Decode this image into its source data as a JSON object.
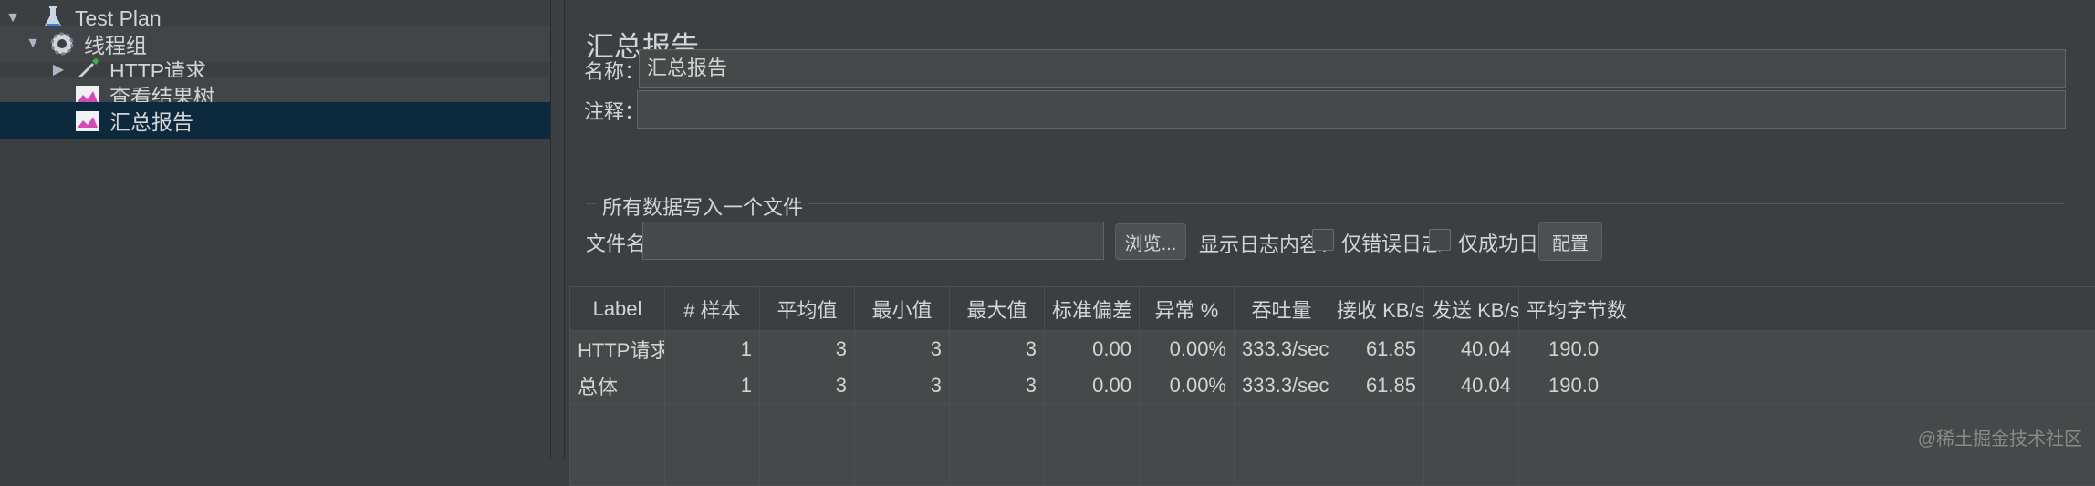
{
  "tree": {
    "items": [
      {
        "label": "Test Plan",
        "icon": "flask-icon"
      },
      {
        "label": "线程组",
        "icon": "gear-icon"
      },
      {
        "label": "HTTP请求",
        "icon": "pipette-icon"
      },
      {
        "label": "查看结果树",
        "icon": "chart-icon"
      },
      {
        "label": "汇总报告",
        "icon": "chart-icon"
      }
    ]
  },
  "panel": {
    "title": "汇总报告",
    "name_label": "名称：",
    "name_value": "汇总报告",
    "comment_label": "注释：",
    "comment_value": "",
    "section_title": "所有数据写入一个文件",
    "file_label": "文件名",
    "file_value": "",
    "browse_label": "浏览...",
    "log_label": "显示日志内容：",
    "errors_only_label": "仅错误日志",
    "success_only_label": "仅成功日志",
    "config_label": "配置"
  },
  "table": {
    "headers": [
      "Label",
      "# 样本",
      "平均值",
      "最小值",
      "最大值",
      "标准偏差",
      "异常 %",
      "吞吐量",
      "接收 KB/sec",
      "发送 KB/sec",
      "平均字节数"
    ],
    "rows": [
      [
        "HTTP请求",
        "1",
        "3",
        "3",
        "3",
        "0.00",
        "0.00%",
        "333.3/sec",
        "61.85",
        "40.04",
        "190.0"
      ],
      [
        "总体",
        "1",
        "3",
        "3",
        "3",
        "0.00",
        "0.00%",
        "333.3/sec",
        "61.85",
        "40.04",
        "190.0"
      ]
    ]
  },
  "watermark": "@稀土掘金技术社区",
  "colors": {
    "background": "#3c3f41",
    "selection": "#0d293e",
    "field": "#45494a"
  }
}
